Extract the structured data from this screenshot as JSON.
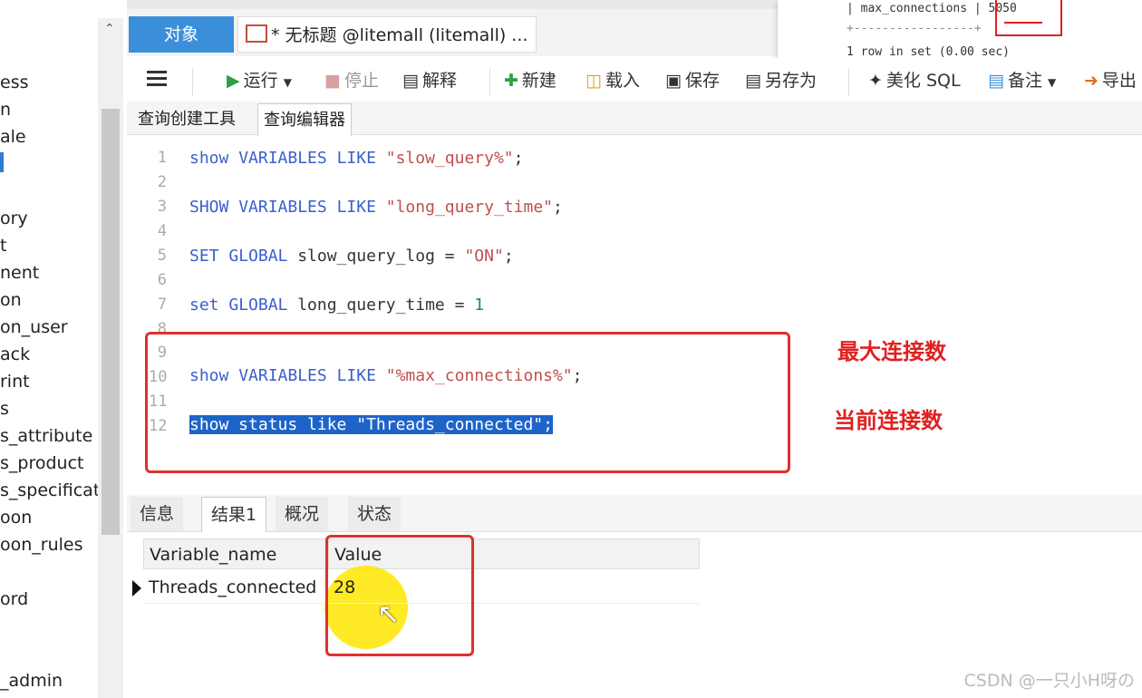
{
  "sidebar": {
    "items": [
      "ess",
      "n",
      "ale",
      "",
      "ory",
      "t",
      "nent",
      "on",
      "on_user",
      "ack",
      "rint",
      "s",
      "s_attribute",
      "s_product",
      "s_specificat",
      "oon",
      "oon_rules",
      "",
      "ord",
      "",
      "_admin"
    ]
  },
  "tabs": {
    "object": "对象",
    "query": "* 无标题 @litemall (litemall) ..."
  },
  "terminal": {
    "line1": "| max_connections | 5050",
    "line2": "+-----------------+",
    "line3": "1 row in set (0.00 sec)"
  },
  "toolbar": {
    "run": "运行",
    "stop": "停止",
    "explain": "解释",
    "new": "新建",
    "load": "载入",
    "save": "保存",
    "save_as": "另存为",
    "beautify": "美化 SQL",
    "comment": "备注",
    "export": "导出"
  },
  "editor_tabs": [
    "查询创建工具",
    "查询编辑器"
  ],
  "code": {
    "line_numbers": [
      "1",
      "2",
      "3",
      "4",
      "5",
      "6",
      "7",
      "8",
      "9",
      "10",
      "11",
      "12"
    ],
    "l1": [
      "show",
      " VARIABLES",
      " LIKE",
      " \"slow_query%\"",
      ";"
    ],
    "l3": [
      "SHOW",
      " VARIABLES",
      " LIKE",
      " \"long_query_time\"",
      ";"
    ],
    "l5": [
      "SET",
      " GLOBAL",
      " slow_query_log = ",
      "\"ON\"",
      ";"
    ],
    "l7": [
      "set",
      " GLOBAL",
      " long_query_time = ",
      "1"
    ],
    "l10": [
      "show",
      " VARIABLES",
      " LIKE",
      " \"%max_connections%\"",
      ";"
    ],
    "l12": "show status like \"Threads_connected\";"
  },
  "annotations": {
    "max_conn": "最大连接数",
    "current_conn": "当前连接数"
  },
  "result_tabs": [
    "信息",
    "结果1",
    "概况",
    "状态"
  ],
  "grid": {
    "headers": [
      "Variable_name",
      "Value"
    ],
    "row": [
      "Threads_connected",
      "28"
    ]
  },
  "watermark": "CSDN @一只小H呀の"
}
